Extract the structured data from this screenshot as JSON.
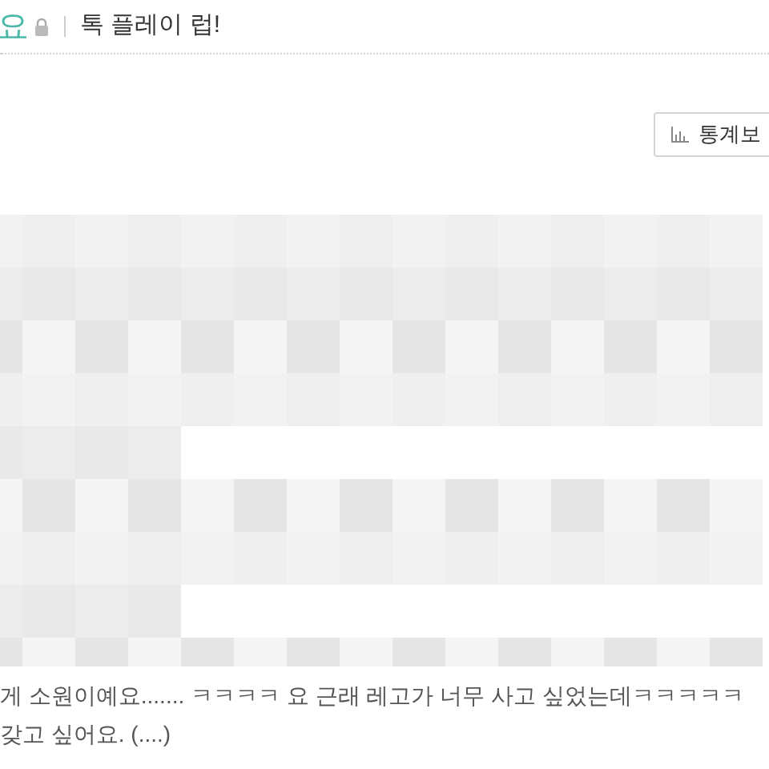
{
  "header": {
    "title_fragment": "요",
    "locked": true,
    "post_title": "톡 플레이 럽!"
  },
  "stats_button": {
    "label": "통계보"
  },
  "post": {
    "lines": [
      "게 소원이예요....... ㅋㅋㅋㅋ 요 근래 레고가 너무 사고 싶었는데ㅋㅋㅋㅋㅋ",
      "갖고 싶어요. (....)"
    ]
  }
}
